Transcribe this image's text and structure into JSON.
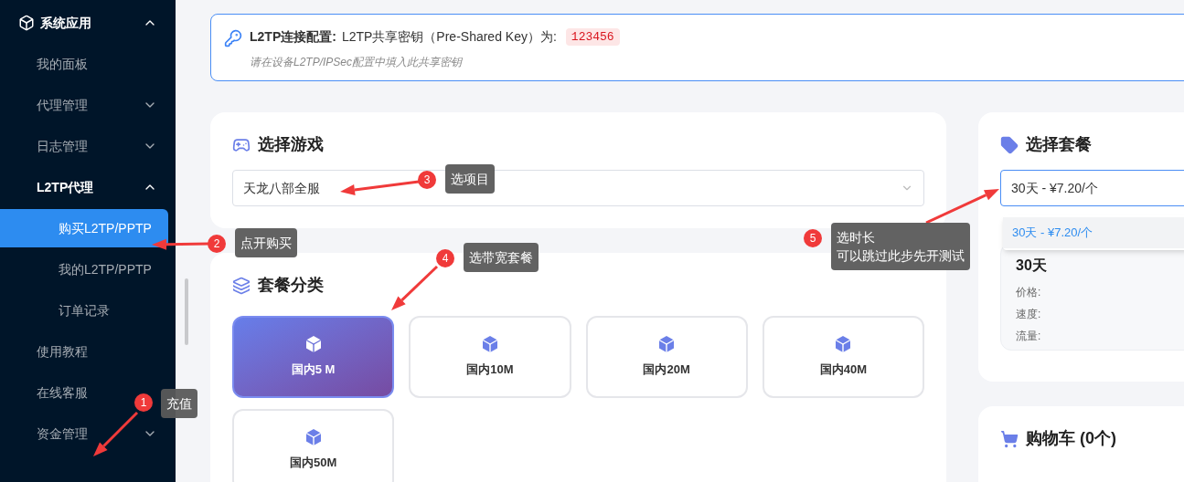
{
  "sidebar": {
    "items": [
      {
        "label": "系统应用",
        "expanded": true,
        "selected": false,
        "children": [
          {
            "label": "我的面板",
            "selected": false
          },
          {
            "label": "代理管理",
            "expanded": false,
            "selected": false
          },
          {
            "label": "日志管理",
            "expanded": false,
            "selected": false
          },
          {
            "label": "L2TP代理",
            "expanded": true,
            "selected": false,
            "children": [
              {
                "label": "购买L2TP/PPTP",
                "selected": true
              },
              {
                "label": "我的L2TP/PPTP",
                "selected": false
              },
              {
                "label": "订单记录",
                "selected": false
              }
            ]
          },
          {
            "label": "使用教程",
            "selected": false
          },
          {
            "label": "在线客服",
            "selected": false
          },
          {
            "label": "资金管理",
            "expanded": false,
            "selected": false
          }
        ]
      }
    ]
  },
  "notice": {
    "title": "L2TP连接配置:",
    "text": "L2TP共享密钥（Pre-Shared Key）为:",
    "key": "123456",
    "hint": "请在设备L2TP/IPSec配置中填入此共享密钥"
  },
  "game_card": {
    "title": "选择游戏",
    "select_value": "天龙八部全服"
  },
  "category_card": {
    "title": "套餐分类",
    "categories": [
      {
        "label": "国内5 M",
        "selected": true
      },
      {
        "label": "国内10M",
        "selected": false
      },
      {
        "label": "国内20M",
        "selected": false
      },
      {
        "label": "国内40M",
        "selected": false
      },
      {
        "label": "国内50M",
        "selected": false
      }
    ]
  },
  "plan_card": {
    "title": "选择套餐",
    "select_value": "30天 - ¥7.20/个",
    "options": [
      {
        "label": "30天 - ¥7.20/个",
        "selected": true
      }
    ],
    "plan_name": "30天",
    "fields": [
      "价格:",
      "速度:",
      "流量:"
    ]
  },
  "cart_card": {
    "title": "购物车 (0个)"
  },
  "annotations": [
    {
      "number": "1",
      "lines": [
        "充值"
      ]
    },
    {
      "number": "2",
      "lines": [
        "点开购买"
      ]
    },
    {
      "number": "3",
      "lines": [
        "选项目"
      ]
    },
    {
      "number": "4",
      "lines": [
        "选带宽套餐"
      ]
    },
    {
      "number": "5",
      "lines": [
        "选时长",
        "可以跳过此步先开测试"
      ]
    }
  ]
}
